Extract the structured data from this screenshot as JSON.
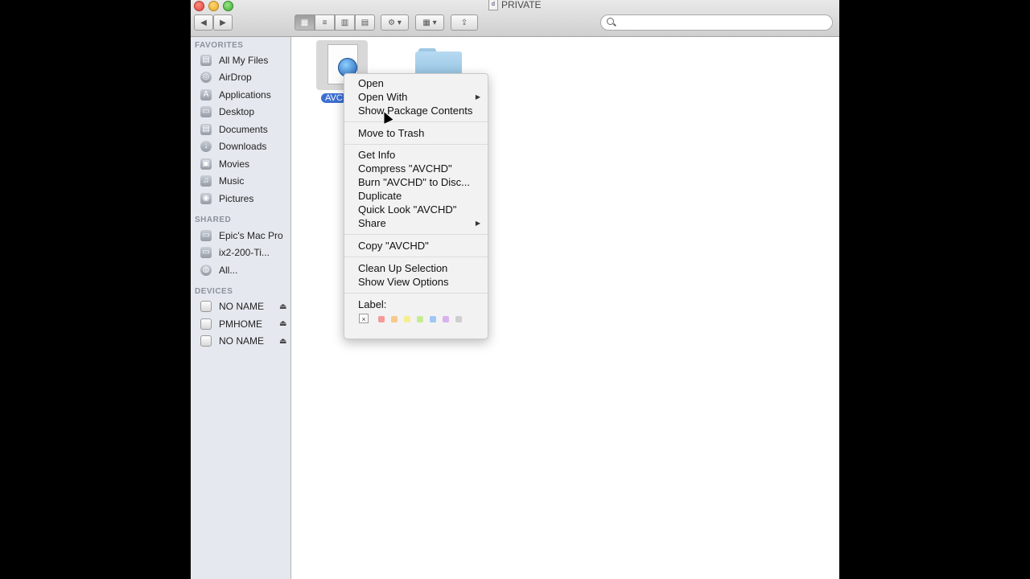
{
  "window": {
    "title": "PRIVATE",
    "title_icon": "document-icon"
  },
  "sidebar": {
    "sections": [
      {
        "heading": "FAVORITES",
        "items": [
          {
            "label": "All My Files",
            "icon": "all-files-icon"
          },
          {
            "label": "AirDrop",
            "icon": "airdrop-icon"
          },
          {
            "label": "Applications",
            "icon": "applications-icon"
          },
          {
            "label": "Desktop",
            "icon": "desktop-icon"
          },
          {
            "label": "Documents",
            "icon": "documents-icon"
          },
          {
            "label": "Downloads",
            "icon": "downloads-icon"
          },
          {
            "label": "Movies",
            "icon": "movies-icon"
          },
          {
            "label": "Music",
            "icon": "music-icon"
          },
          {
            "label": "Pictures",
            "icon": "pictures-icon"
          }
        ]
      },
      {
        "heading": "SHARED",
        "items": [
          {
            "label": "Epic's Mac Pro",
            "icon": "computer-icon"
          },
          {
            "label": "ix2-200-Ti...",
            "icon": "network-drive-icon"
          },
          {
            "label": "All...",
            "icon": "network-icon"
          }
        ]
      },
      {
        "heading": "DEVICES",
        "items": [
          {
            "label": "NO NAME",
            "icon": "disk-icon",
            "eject": "⏏"
          },
          {
            "label": "PMHOME",
            "icon": "disk-icon",
            "eject": "⏏"
          },
          {
            "label": "NO NAME",
            "icon": "disk-icon",
            "eject": "⏏"
          }
        ]
      }
    ]
  },
  "content": {
    "items": [
      {
        "label": "AVC",
        "icon": "quicktime-document-icon",
        "selected": true
      },
      {
        "label": "",
        "icon": "folder-icon",
        "selected": false
      }
    ]
  },
  "context_menu": {
    "groups": [
      [
        {
          "label": "Open"
        },
        {
          "label": "Open With",
          "arrow": "▶"
        },
        {
          "label": "Show Package Contents"
        }
      ],
      [
        {
          "label": "Move to Trash"
        }
      ],
      [
        {
          "label": "Get Info"
        },
        {
          "label": "Compress \"AVCHD\""
        },
        {
          "label": "Burn \"AVCHD\" to Disc..."
        },
        {
          "label": "Duplicate"
        },
        {
          "label": "Quick Look \"AVCHD\""
        },
        {
          "label": "Share",
          "arrow": "▶"
        }
      ],
      [
        {
          "label": "Copy \"AVCHD\""
        }
      ],
      [
        {
          "label": "Clean Up Selection"
        },
        {
          "label": "Show View Options"
        }
      ]
    ],
    "label_heading": "Label:",
    "label_none": "×",
    "label_colors": [
      "#f59a9a",
      "#f8c98a",
      "#f6ee8e",
      "#c6ec93",
      "#9fc7f4",
      "#d7b2ee",
      "#cfcfcf"
    ]
  }
}
